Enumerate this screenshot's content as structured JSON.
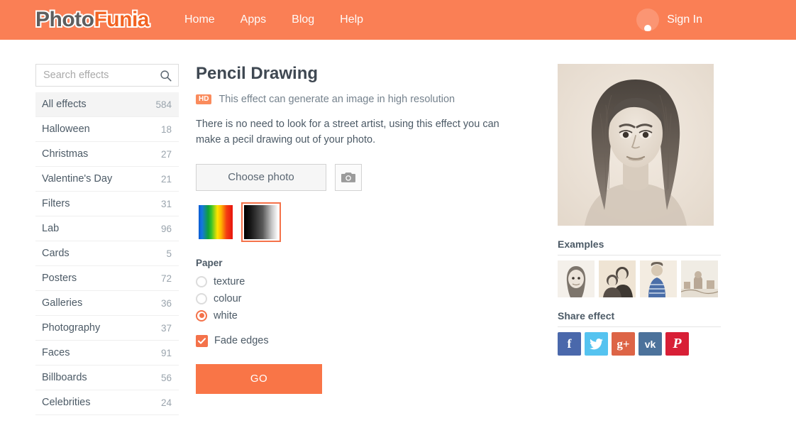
{
  "header": {
    "logo_part1": "Photo",
    "logo_part2": "Funia",
    "nav": [
      {
        "label": "Home"
      },
      {
        "label": "Apps"
      },
      {
        "label": "Blog"
      },
      {
        "label": "Help"
      }
    ],
    "signin_label": "Sign In",
    "avatar_icon": "user-avatar-icon",
    "bg_color": "#fa7f55"
  },
  "sidebar": {
    "search": {
      "placeholder": "Search effects",
      "value": "",
      "icon": "search-icon"
    },
    "categories": [
      {
        "label": "All effects",
        "count": "584",
        "active": true
      },
      {
        "label": "Halloween",
        "count": "18",
        "active": false
      },
      {
        "label": "Christmas",
        "count": "27",
        "active": false
      },
      {
        "label": "Valentine's Day",
        "count": "21",
        "active": false
      },
      {
        "label": "Filters",
        "count": "31",
        "active": false
      },
      {
        "label": "Lab",
        "count": "96",
        "active": false
      },
      {
        "label": "Cards",
        "count": "5",
        "active": false
      },
      {
        "label": "Posters",
        "count": "72",
        "active": false
      },
      {
        "label": "Galleries",
        "count": "36",
        "active": false
      },
      {
        "label": "Photography",
        "count": "37",
        "active": false
      },
      {
        "label": "Faces",
        "count": "91",
        "active": false
      },
      {
        "label": "Billboards",
        "count": "56",
        "active": false
      },
      {
        "label": "Celebrities",
        "count": "24",
        "active": false
      }
    ]
  },
  "main": {
    "title": "Pencil Drawing",
    "hd_badge": "HD",
    "hd_text": "This effect can generate an image in high resolution",
    "description": "There is no need to look for a street artist, using this effect you can make a pecil drawing out of your photo.",
    "choose_photo_label": "Choose photo",
    "camera_icon": "camera-icon",
    "swatches": [
      {
        "name": "colour-swatch",
        "selected": false
      },
      {
        "name": "black-white-swatch",
        "selected": true
      }
    ],
    "paper_group_label": "Paper",
    "paper_options": [
      {
        "label": "texture",
        "checked": false
      },
      {
        "label": "colour",
        "checked": false
      },
      {
        "label": "white",
        "checked": true
      }
    ],
    "fade_edges_label": "Fade edges",
    "fade_edges_checked": true,
    "go_label": "GO",
    "accent_color": "#f4724a",
    "go_color": "#f97547"
  },
  "right": {
    "preview_alt": "pencil-drawing-portrait-preview",
    "examples_title": "Examples",
    "examples": [
      {
        "name": "example-thumb-portrait-woman"
      },
      {
        "name": "example-thumb-couple"
      },
      {
        "name": "example-thumb-person-scarf"
      },
      {
        "name": "example-thumb-cityscape"
      }
    ],
    "share_title": "Share effect",
    "share_buttons": [
      {
        "name": "facebook",
        "glyph": "f",
        "color": "#4a68ab"
      },
      {
        "name": "twitter",
        "glyph": "t",
        "color": "#55c3f0"
      },
      {
        "name": "googleplus",
        "glyph": "g+",
        "color": "#dd6446"
      },
      {
        "name": "vk",
        "glyph": "vk",
        "color": "#4c729b"
      },
      {
        "name": "pinterest",
        "glyph": "P",
        "color": "#d81f36"
      }
    ]
  }
}
